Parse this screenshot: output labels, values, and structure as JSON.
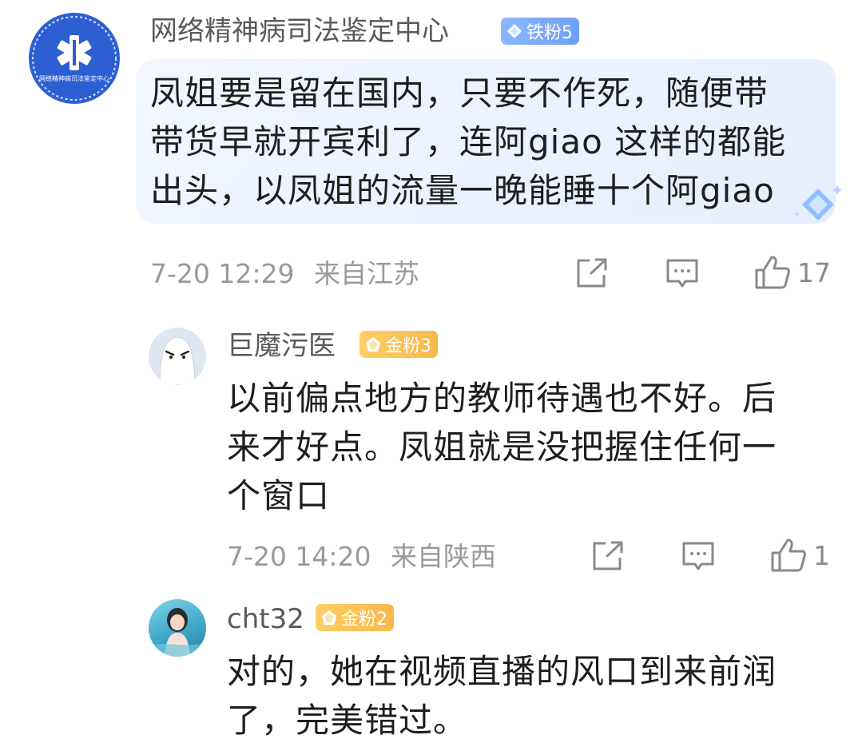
{
  "comments": [
    {
      "username": "网络精神病司法鉴定中心",
      "badge": "铁粉5",
      "avatar_text": "网络精神病司法鉴定中心",
      "lines": [
        "凤姐要是留在国内，只要不作死，随便带",
        "带货早就开宾利了，连阿giao 这样的都能",
        "出头，以凤姐的流量一晚能睡十个阿giao"
      ],
      "time": "7-20 12:29",
      "location": "来自江苏",
      "likes": "17"
    },
    {
      "username": "巨魔污医",
      "badge": "金粉3",
      "lines": [
        "以前偏点地方的教师待遇也不好。后",
        "来才好点。凤姐就是没把握住任何一",
        "个窗口"
      ],
      "time": "7-20 14:20",
      "location": "来自陕西",
      "likes": "1"
    },
    {
      "username": "cht32",
      "badge": "金粉2",
      "lines": [
        "对的，她在视频直播的风口到来前润",
        "了，完美错过。"
      ]
    }
  ],
  "colors": {
    "badge_blue": "#7aa8fa",
    "badge_gold": "#f9be4f",
    "bubble": "#eef4ff",
    "meta_gray": "#9a9a9a"
  },
  "icons": [
    "share-icon",
    "comment-icon",
    "like-icon",
    "diamond-icon",
    "medical-star-icon"
  ]
}
